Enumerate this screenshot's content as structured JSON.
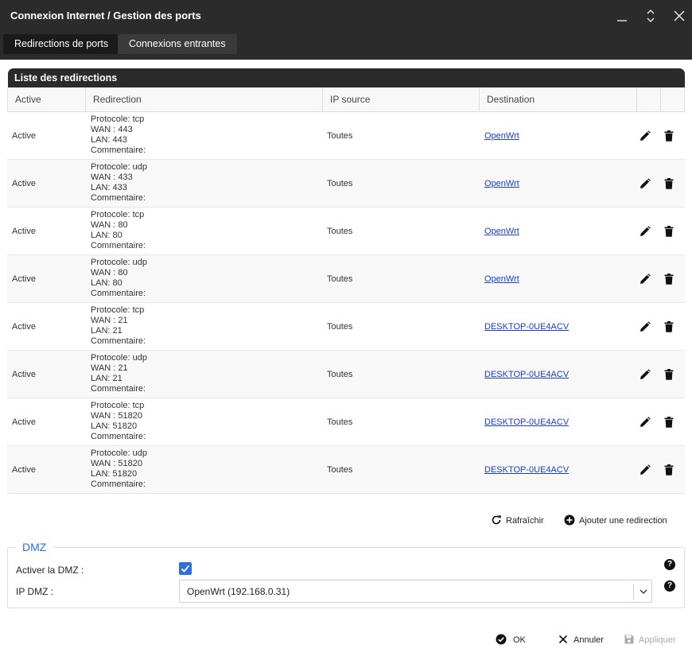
{
  "window": {
    "title": "Connexion Internet / Gestion des ports"
  },
  "tabs": [
    {
      "label": "Redirections de ports"
    },
    {
      "label": "Connexions entrantes"
    }
  ],
  "list": {
    "title": "Liste des redirections",
    "columns": [
      "Active",
      "Redirection",
      "IP source",
      "Destination"
    ],
    "rows": [
      {
        "active": "Active",
        "protocol": "Protocole: tcp",
        "wan": "WAN : 443",
        "lan": "LAN: 443",
        "comment": "Commentaire:",
        "ip_source": "Toutes",
        "destination": "OpenWrt"
      },
      {
        "active": "Active",
        "protocol": "Protocole: udp",
        "wan": "WAN : 433",
        "lan": "LAN: 433",
        "comment": "Commentaire:",
        "ip_source": "Toutes",
        "destination": "OpenWrt"
      },
      {
        "active": "Active",
        "protocol": "Protocole: tcp",
        "wan": "WAN : 80",
        "lan": "LAN: 80",
        "comment": "Commentaire:",
        "ip_source": "Toutes",
        "destination": "OpenWrt"
      },
      {
        "active": "Active",
        "protocol": "Protocole: udp",
        "wan": "WAN : 80",
        "lan": "LAN: 80",
        "comment": "Commentaire:",
        "ip_source": "Toutes",
        "destination": "OpenWrt"
      },
      {
        "active": "Active",
        "protocol": "Protocole: tcp",
        "wan": "WAN : 21",
        "lan": "LAN: 21",
        "comment": "Commentaire:",
        "ip_source": "Toutes",
        "destination": "DESKTOP-0UE4ACV"
      },
      {
        "active": "Active",
        "protocol": "Protocole: udp",
        "wan": "WAN : 21",
        "lan": "LAN: 21",
        "comment": "Commentaire:",
        "ip_source": "Toutes",
        "destination": "DESKTOP-0UE4ACV"
      },
      {
        "active": "Active",
        "protocol": "Protocole: tcp",
        "wan": "WAN : 51820",
        "lan": "LAN: 51820",
        "comment": "Commentaire:",
        "ip_source": "Toutes",
        "destination": "DESKTOP-0UE4ACV"
      },
      {
        "active": "Active",
        "protocol": "Protocole: udp",
        "wan": "WAN : 51820",
        "lan": "LAN: 51820",
        "comment": "Commentaire:",
        "ip_source": "Toutes",
        "destination": "DESKTOP-0UE4ACV"
      }
    ]
  },
  "actions": {
    "refresh": "Rafraîchir",
    "add": "Ajouter une redirection"
  },
  "dmz": {
    "legend": "DMZ",
    "enable_label": "Activer la DMZ :",
    "enabled": true,
    "ip_label": "IP DMZ :",
    "ip_value": "OpenWrt (192.168.0.31)"
  },
  "footer": {
    "ok": "OK",
    "cancel": "Annuler",
    "apply": "Appliquer"
  },
  "colors": {
    "titlebar": "#2b2b2b",
    "accent": "#2f6fe0",
    "link": "#1a3ed6"
  }
}
